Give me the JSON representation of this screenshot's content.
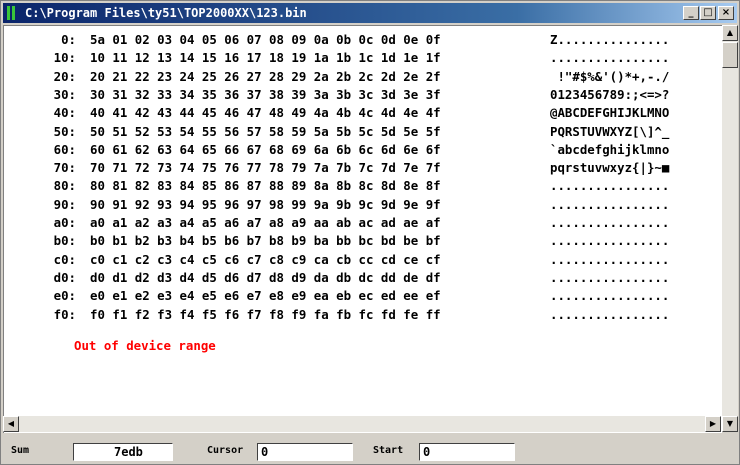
{
  "window": {
    "title": "C:\\Program Files\\ty51\\TOP2000XX\\123.bin",
    "controls": [
      "_",
      "□",
      "×"
    ]
  },
  "rows": [
    {
      "addr": "0:",
      "bytes": "5a 01 02 03 04 05 06 07 08 09 0a 0b 0c 0d 0e 0f",
      "ascii": "Z..............."
    },
    {
      "addr": "10:",
      "bytes": "10 11 12 13 14 15 16 17 18 19 1a 1b 1c 1d 1e 1f",
      "ascii": "................"
    },
    {
      "addr": "20:",
      "bytes": "20 21 22 23 24 25 26 27 28 29 2a 2b 2c 2d 2e 2f",
      "ascii": " !\"#$%&'()*+,-./"
    },
    {
      "addr": "30:",
      "bytes": "30 31 32 33 34 35 36 37 38 39 3a 3b 3c 3d 3e 3f",
      "ascii": "0123456789:;<=>?"
    },
    {
      "addr": "40:",
      "bytes": "40 41 42 43 44 45 46 47 48 49 4a 4b 4c 4d 4e 4f",
      "ascii": "@ABCDEFGHIJKLMNO"
    },
    {
      "addr": "50:",
      "bytes": "50 51 52 53 54 55 56 57 58 59 5a 5b 5c 5d 5e 5f",
      "ascii": "PQRSTUVWXYZ[\\]^_"
    },
    {
      "addr": "60:",
      "bytes": "60 61 62 63 64 65 66 67 68 69 6a 6b 6c 6d 6e 6f",
      "ascii": "`abcdefghijklmno"
    },
    {
      "addr": "70:",
      "bytes": "70 71 72 73 74 75 76 77 78 79 7a 7b 7c 7d 7e 7f",
      "ascii": "pqrstuvwxyz{|}~■"
    },
    {
      "addr": "80:",
      "bytes": "80 81 82 83 84 85 86 87 88 89 8a 8b 8c 8d 8e 8f",
      "ascii": "................"
    },
    {
      "addr": "90:",
      "bytes": "90 91 92 93 94 95 96 97 98 99 9a 9b 9c 9d 9e 9f",
      "ascii": "................"
    },
    {
      "addr": "a0:",
      "bytes": "a0 a1 a2 a3 a4 a5 a6 a7 a8 a9 aa ab ac ad ae af",
      "ascii": "................"
    },
    {
      "addr": "b0:",
      "bytes": "b0 b1 b2 b3 b4 b5 b6 b7 b8 b9 ba bb bc bd be bf",
      "ascii": "................"
    },
    {
      "addr": "c0:",
      "bytes": "c0 c1 c2 c3 c4 c5 c6 c7 c8 c9 ca cb cc cd ce cf",
      "ascii": "................"
    },
    {
      "addr": "d0:",
      "bytes": "d0 d1 d2 d3 d4 d5 d6 d7 d8 d9 da db dc dd de df",
      "ascii": "................"
    },
    {
      "addr": "e0:",
      "bytes": "e0 e1 e2 e3 e4 e5 e6 e7 e8 e9 ea eb ec ed ee ef",
      "ascii": "................"
    },
    {
      "addr": "f0:",
      "bytes": "f0 f1 f2 f3 f4 f5 f6 f7 f8 f9 fa fb fc fd fe ff",
      "ascii": "................"
    }
  ],
  "error_message": "Out of device range",
  "status": {
    "sum_label": "Sum",
    "sum_value": "7edb",
    "cursor_label": "Cursor",
    "cursor_value": "0",
    "start_label": "Start",
    "start_value": "0"
  },
  "colors": {
    "error": "#ff0000",
    "title_gradient_start": "#0a246a",
    "title_gradient_end": "#a6caf0"
  }
}
